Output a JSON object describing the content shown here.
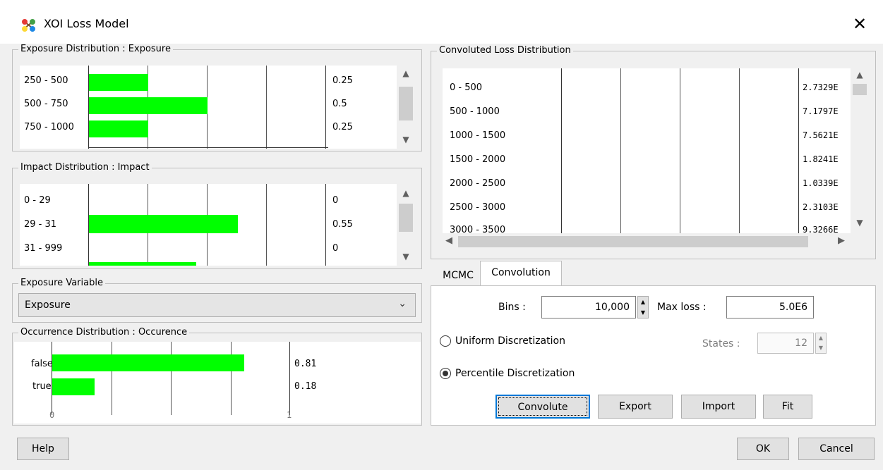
{
  "window": {
    "title": "XOI Loss Model",
    "close_glyph": "✕",
    "icon": "network-nodes-icon"
  },
  "exposure_dist": {
    "title": "Exposure Distribution : Exposure",
    "rows": [
      {
        "label": "250 - 500",
        "value": "0.25",
        "fraction": 0.25
      },
      {
        "label": "500 - 750",
        "value": "0.5",
        "fraction": 0.5
      },
      {
        "label": "750 - 1000",
        "value": "0.25",
        "fraction": 0.25
      }
    ]
  },
  "impact_dist": {
    "title": "Impact Distribution : Impact",
    "rows": [
      {
        "label": "0 - 29",
        "value": "0",
        "fraction": 0
      },
      {
        "label": "29 - 31",
        "value": "0.55",
        "fraction": 0.55
      },
      {
        "label": "31 - 999",
        "value": "0",
        "fraction": 0
      }
    ]
  },
  "exposure_variable": {
    "title": "Exposure Variable",
    "selected": "Exposure"
  },
  "occurrence_dist": {
    "title": "Occurrence Distribution : Occurence",
    "rows": [
      {
        "label": "false",
        "value": "0.81",
        "fraction": 0.81
      },
      {
        "label": "true",
        "value": "0.18",
        "fraction": 0.18
      }
    ],
    "axis_min": "0",
    "axis_max": "1"
  },
  "convoluted": {
    "title": "Convoluted Loss Distribution",
    "rows": [
      {
        "label": "0 - 500",
        "value": "2.7329E"
      },
      {
        "label": "500 - 1000",
        "value": "7.1797E"
      },
      {
        "label": "1000 - 1500",
        "value": "7.5621E"
      },
      {
        "label": "1500 - 2000",
        "value": "1.8241E"
      },
      {
        "label": "2000 - 2500",
        "value": "1.0339E"
      },
      {
        "label": "2500 - 3000",
        "value": "2.3103E"
      },
      {
        "label": "3000 - 3500",
        "value": "9.3266E"
      }
    ]
  },
  "tabs": [
    {
      "label": "MCMC",
      "active": false
    },
    {
      "label": "Convolution",
      "active": true
    }
  ],
  "convolution": {
    "bins_label": "Bins :",
    "bins_value": "10,000",
    "maxloss_label": "Max loss :",
    "maxloss_value": "5.0E6",
    "uniform_label": "Uniform Discretization",
    "uniform_selected": false,
    "states_label": "States :",
    "states_value": "12",
    "percentile_label": "Percentile Discretization",
    "percentile_selected": true,
    "buttons": {
      "convolute": "Convolute",
      "export": "Export",
      "import": "Import",
      "fit": "Fit"
    }
  },
  "footer": {
    "help": "Help",
    "ok": "OK",
    "cancel": "Cancel"
  },
  "colors": {
    "bar": "#00ff00",
    "background": "#f0f0f0"
  }
}
